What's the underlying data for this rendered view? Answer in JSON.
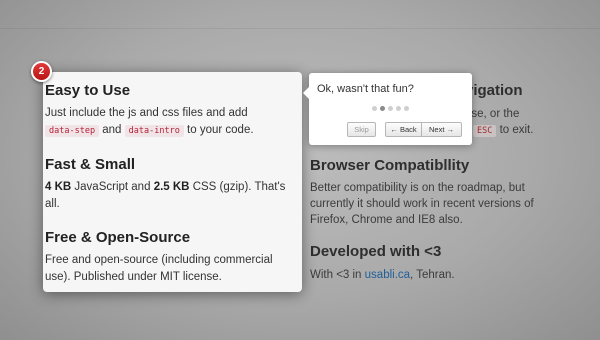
{
  "left_sections": [
    {
      "title": "Easy to Use",
      "text_1": "Just include the js and css files and add",
      "code_1": "data-step",
      "and": "and",
      "code_2": "data-intro",
      "text_2": "to your code."
    },
    {
      "title": "Fast & Small",
      "size_1": "4 KB",
      "text_1": "JavaScript and",
      "size_2": "2.5 KB",
      "text_2": "CSS (gzip). That's all."
    },
    {
      "title": "Free & Open-Source",
      "text": "Free and open-source (including commercial use). Published under MIT license."
    }
  ],
  "right_sections": [
    {
      "title_visible": "vigation",
      "line_1": "use, or the",
      "code": "ESC",
      "line_2_suffix": "to exit."
    },
    {
      "title": "Browser Compatibllity",
      "text": "Better compatibility is on the roadmap, but currently it should work in recent versions of Firefox, Chrome and IE8 also."
    },
    {
      "title": "Developed with <3",
      "text_before": "With <3 in",
      "link": "usabli.ca",
      "text_after": ", Tehran."
    }
  ],
  "step_badge": {
    "number": "2",
    "color": "#d42a2a"
  },
  "tooltip": {
    "text": "Ok, wasn't that fun?",
    "bullets_total": 5,
    "active_bullet": 2,
    "skip_label": "Skip",
    "back_label": "← Back",
    "next_label": "Next →"
  }
}
